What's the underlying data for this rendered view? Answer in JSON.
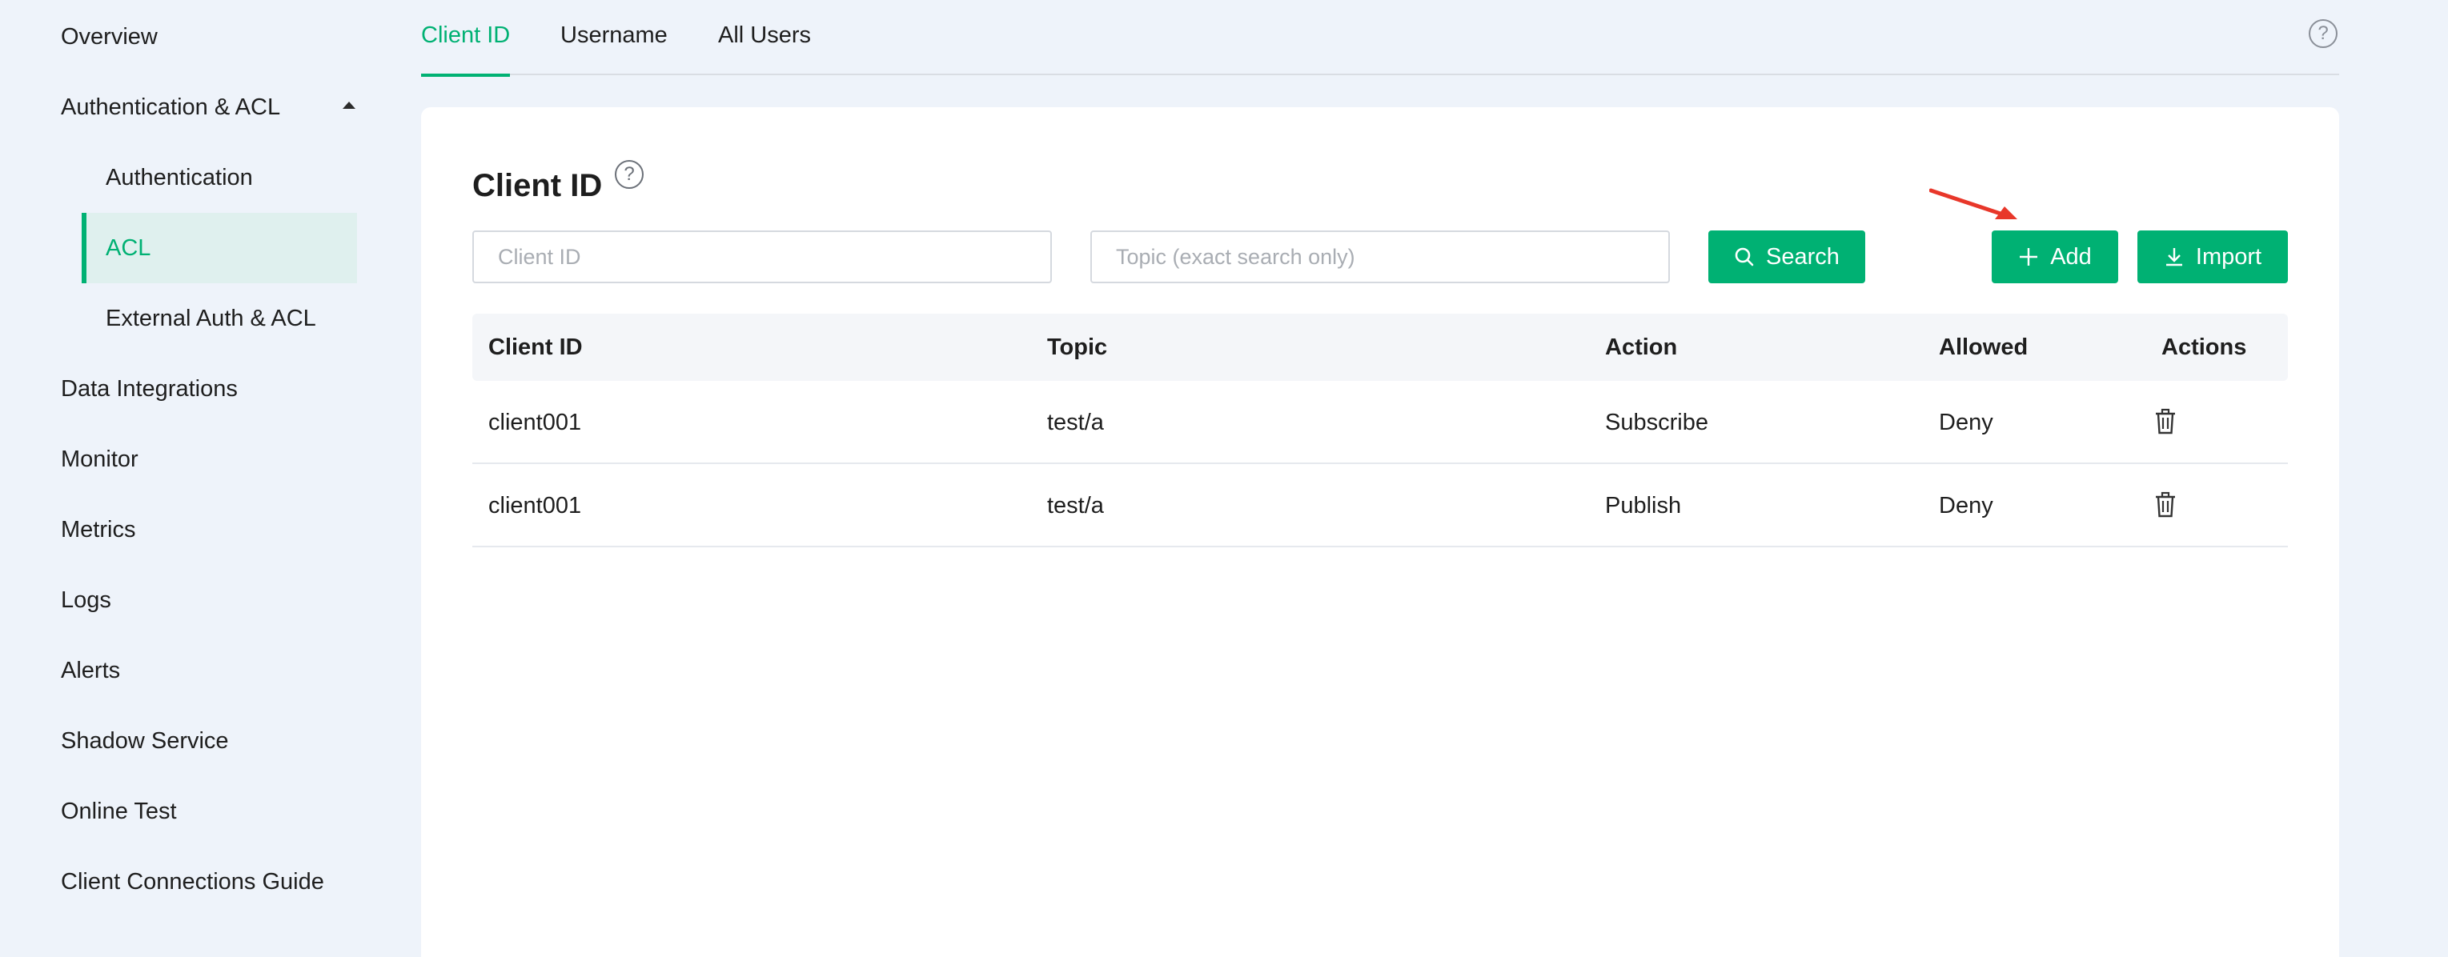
{
  "sidebar": {
    "items": [
      {
        "label": "Overview"
      },
      {
        "label": "Authentication & ACL"
      },
      {
        "label": "Data Integrations"
      },
      {
        "label": "Monitor"
      },
      {
        "label": "Metrics"
      },
      {
        "label": "Logs"
      },
      {
        "label": "Alerts"
      },
      {
        "label": "Shadow Service"
      },
      {
        "label": "Online Test"
      },
      {
        "label": "Client Connections Guide"
      }
    ],
    "sub_items": [
      {
        "label": "Authentication"
      },
      {
        "label": "ACL"
      },
      {
        "label": "External Auth & ACL"
      }
    ]
  },
  "tabs": [
    {
      "label": "Client ID"
    },
    {
      "label": "Username"
    },
    {
      "label": "All Users"
    }
  ],
  "page": {
    "title": "Client ID",
    "help_icon": "?"
  },
  "filters": {
    "client_id_placeholder": "Client ID",
    "topic_placeholder": "Topic (exact search only)"
  },
  "buttons": {
    "search": "Search",
    "add": "Add",
    "import": "Import"
  },
  "table": {
    "headers": [
      "Client ID",
      "Topic",
      "Action",
      "Allowed",
      "Actions"
    ],
    "rows": [
      {
        "client_id": "client001",
        "topic": "test/a",
        "action": "Subscribe",
        "allowed": "Deny"
      },
      {
        "client_id": "client001",
        "topic": "test/a",
        "action": "Publish",
        "allowed": "Deny"
      }
    ]
  },
  "colors": {
    "accent": "#00b173",
    "background": "#eef3fa",
    "annotation_arrow": "#e8372a"
  },
  "icons": {
    "help": "question-circle-icon",
    "search": "search-icon",
    "add": "plus-icon",
    "import": "download-icon",
    "delete": "trash-icon",
    "collapse": "caret-up-icon"
  }
}
